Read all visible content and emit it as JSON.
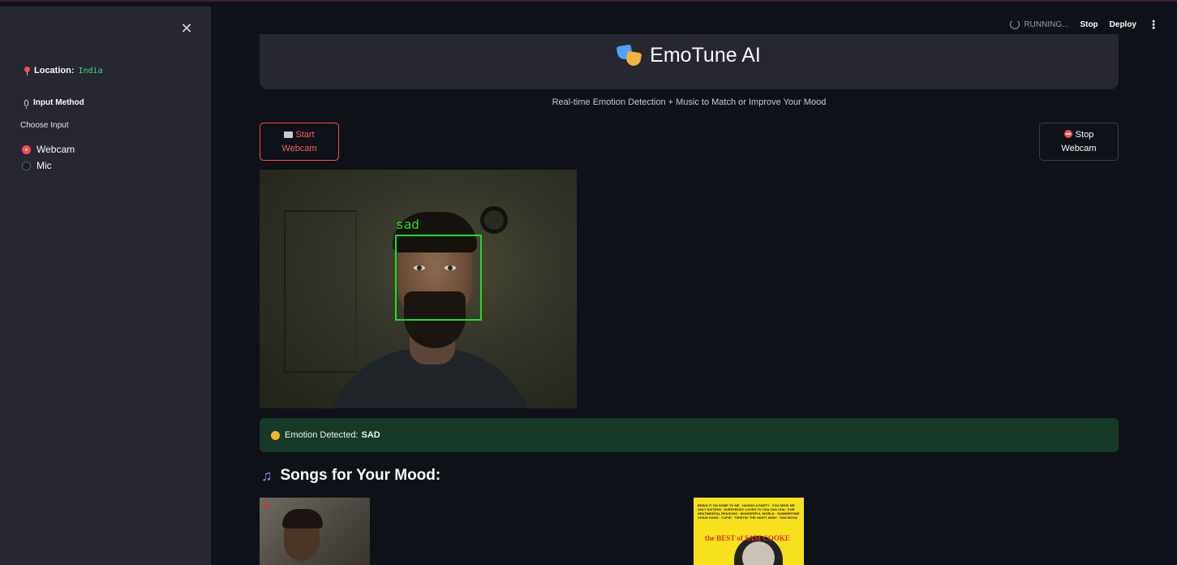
{
  "sidebar": {
    "location_label": "Location:",
    "location_value": "India",
    "input_method_heading": "Input Method",
    "choose_input_label": "Choose Input",
    "options": [
      {
        "label": "Webcam",
        "selected": true
      },
      {
        "label": "Mic",
        "selected": false
      }
    ]
  },
  "toolbar": {
    "status": "RUNNING...",
    "stop_label": "Stop",
    "deploy_label": "Deploy",
    "menu_glyph": "⋮"
  },
  "header": {
    "title": "EmoTune AI",
    "subtitle": "Real-time Emotion Detection + Music to Match or Improve Your Mood"
  },
  "buttons": {
    "start_line1": "Start",
    "start_line2": "Webcam",
    "stop_line1": "Stop",
    "stop_line2": "Webcam"
  },
  "webcam": {
    "face_label": "sad"
  },
  "alert": {
    "prefix": "Emotion Detected:",
    "emotion": "SAD"
  },
  "songs": {
    "heading": "Songs for Your Mood:"
  },
  "albums": {
    "album2_text": "BRING IT ON HOME TO ME · HAVING A PARTY · YOU SEND ME ONLY SIXTEEN · EVERYBODY LOVES TO CHA CHA CHA · FOR SENTIMENTAL REASONS · WONDERFUL WORLD · SUMMERTIME CHAIN GANG · CUPID · TWISTIN' THE NIGHT AWAY · SAD MOOD",
    "album2_best": "the BEST of SAM COOKE"
  },
  "colors": {
    "accent": "#ff4b4b",
    "success_bg": "#173927",
    "face_box": "#22dd22",
    "sidebar_bg": "#262730",
    "page_bg": "#0e1117"
  }
}
